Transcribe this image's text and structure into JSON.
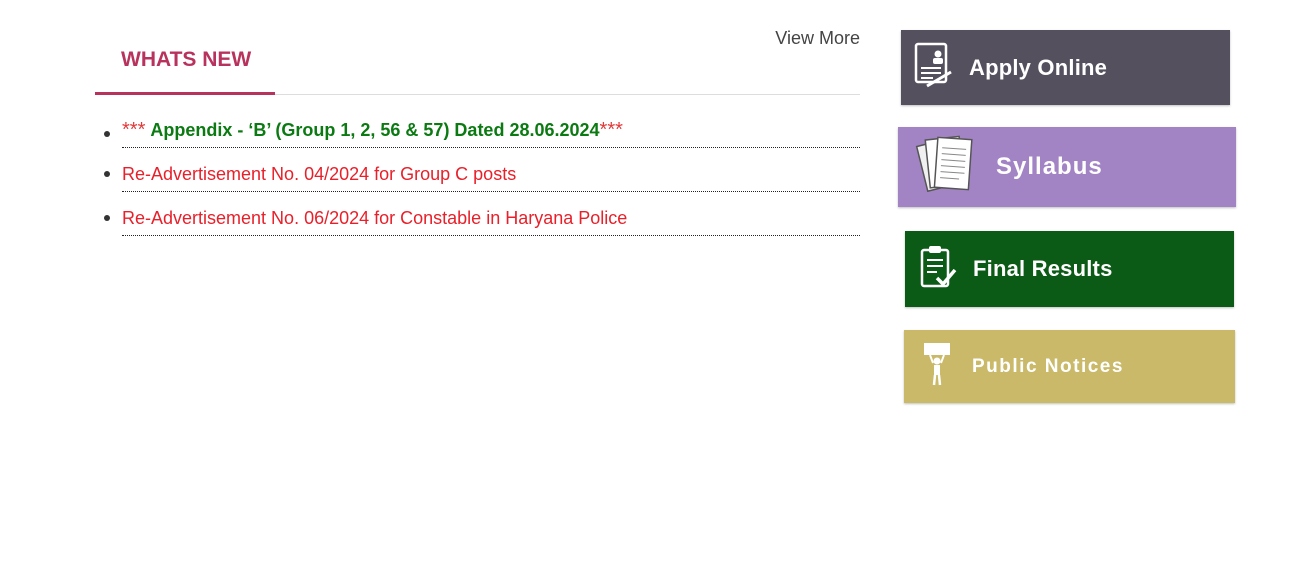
{
  "news": {
    "tab_title": "WHATS NEW",
    "view_more": "View More",
    "items": [
      {
        "prefix": "***",
        "text": "Appendix - ‘B’ (Group 1, 2, 56 & 57) Dated 28.06.2024",
        "suffix": "***"
      },
      {
        "text": "Re-Advertisement No. 04/2024 for Group C posts"
      },
      {
        "text": "Re-Advertisement No. 06/2024 for Constable in Haryana Police"
      }
    ]
  },
  "quick_links": {
    "apply_online": {
      "label": "Apply Online",
      "icon": "application-form-icon",
      "color": "#55505e"
    },
    "syllabus": {
      "label": "Syllabus",
      "icon": "documents-stack-icon",
      "color": "#a284c4"
    },
    "final_results": {
      "label": "Final Results",
      "icon": "checklist-icon",
      "color": "#0b5a16"
    },
    "public_notices": {
      "label": "Public Notices",
      "icon": "person-holding-sign-icon",
      "color": "#c9b968"
    }
  },
  "colors": {
    "accent": "#b8325e",
    "highlight_green": "#0c7a12",
    "link_red": "#e8202a"
  }
}
